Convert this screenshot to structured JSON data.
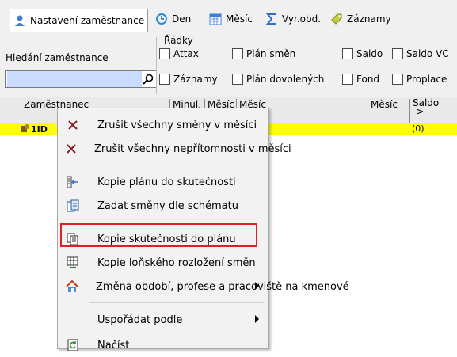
{
  "tabs": [
    {
      "label": "Nastavení zaměstnance",
      "icon": "user-icon"
    },
    {
      "label": "Den",
      "icon": "clock-icon"
    },
    {
      "label": "Měsíc",
      "icon": "calendar-icon"
    },
    {
      "label": "Vyr.obd.",
      "icon": "sigma-icon"
    },
    {
      "label": "Záznamy",
      "icon": "tag-icon"
    }
  ],
  "search": {
    "label": "Hledání zaměstnance",
    "value": ""
  },
  "rows_group": {
    "title": "Řádky",
    "checkboxes": [
      {
        "label": "Attax",
        "checked": false
      },
      {
        "label": "Plán směn",
        "checked": false
      },
      {
        "label": "Saldo",
        "checked": false
      },
      {
        "label": "Saldo VC",
        "checked": false
      },
      {
        "label": "Záznamy",
        "checked": false
      },
      {
        "label": "Plán dovolených",
        "checked": false
      },
      {
        "label": "Fond",
        "checked": false
      },
      {
        "label": "Proplace",
        "checked": false
      }
    ]
  },
  "grid": {
    "columns": [
      "Zaměstnanec",
      "Minul.",
      "Měsíc",
      "Měsíc",
      "Měsíc",
      "Saldo"
    ],
    "saldo_arrow": "->",
    "row": {
      "id": "1ID",
      "saldo": "(0)"
    }
  },
  "menu": [
    {
      "label": "Zrušit všechny směny v měsíci",
      "icon": "cross-icon"
    },
    {
      "label": "Zrušit všechny nepřítomnosti v měsíci",
      "icon": "cross-icon"
    },
    {
      "label": "Kopie plánu do skutečnosti",
      "icon": "copy-plan-icon"
    },
    {
      "label": "Zadat směny dle schématu",
      "icon": "schema-icon"
    },
    {
      "label": "Kopie skutečnosti do plánu",
      "icon": "copy-icon"
    },
    {
      "label": "Kopie loňského rozložení směn",
      "icon": "grid-copy-icon"
    },
    {
      "label": "Změna období, profese a pracoviště na kmenové",
      "icon": "home-icon"
    },
    {
      "label": "Uspořádat podle",
      "icon": ""
    },
    {
      "label": "Načíst",
      "icon": "refresh-icon"
    }
  ]
}
